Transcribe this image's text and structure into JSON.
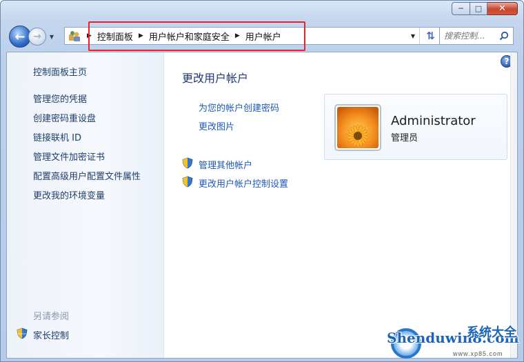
{
  "window": {
    "minimize_icon": "minimize-icon",
    "maximize_icon": "maximize-icon",
    "close_icon": "close-icon"
  },
  "nav": {
    "back_icon": "back-arrow-icon",
    "forward_icon": "forward-arrow-icon",
    "breadcrumbs": [
      "控制面板",
      "用户帐户和家庭安全",
      "用户帐户"
    ],
    "search_placeholder": "搜索控制...",
    "highlight_color": "#e8212a"
  },
  "sidebar": {
    "home": "控制面板主页",
    "links": [
      "管理您的凭据",
      "创建密码重设盘",
      "链接联机 ID",
      "管理文件加密证书",
      "配置高级用户配置文件属性",
      "更改我的环境变量"
    ],
    "see_also": "另请参阅",
    "see_also_links": [
      "家长控制"
    ]
  },
  "main": {
    "title": "更改用户帐户",
    "links": [
      "为您的帐户创建密码",
      "更改图片"
    ],
    "shield_links": [
      "管理其他帐户",
      "更改用户帐户控制设置"
    ]
  },
  "user": {
    "name": "Administrator",
    "role": "管理员"
  },
  "watermark": {
    "text": "Shenduwin8.com",
    "cn": "系统大全",
    "url": "www.xp85.com"
  }
}
